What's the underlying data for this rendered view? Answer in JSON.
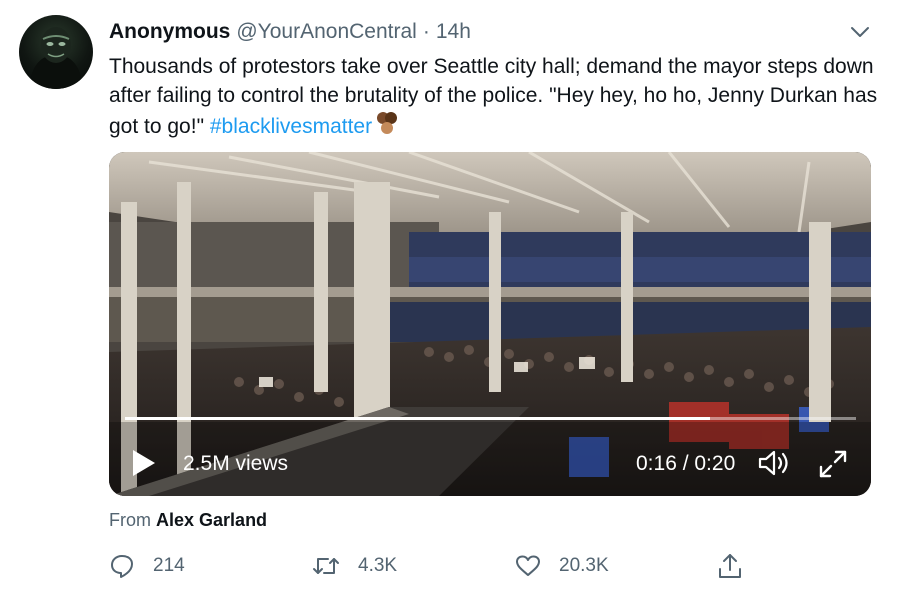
{
  "author": {
    "name": "Anonymous",
    "handle": "@YourAnonCentral",
    "separator": "·",
    "time": "14h"
  },
  "tweet": {
    "text": "Thousands of protestors take over Seattle city hall; demand the mayor steps down after failing to control the brutality of the police. \"Hey hey, ho ho, Jenny Durkan has got to go!\"",
    "hashtag": "#blacklivesmatter"
  },
  "video": {
    "views": "2.5M views",
    "time_display": "0:16 / 0:20",
    "progress_fraction": 0.8
  },
  "attribution": {
    "prefix": "From",
    "name": "Alex Garland"
  },
  "actions": {
    "reply_count": "214",
    "retweet_count": "4.3K",
    "like_count": "20.3K"
  },
  "colors": {
    "link": "#1d9bf0",
    "secondary_text": "#536471"
  }
}
